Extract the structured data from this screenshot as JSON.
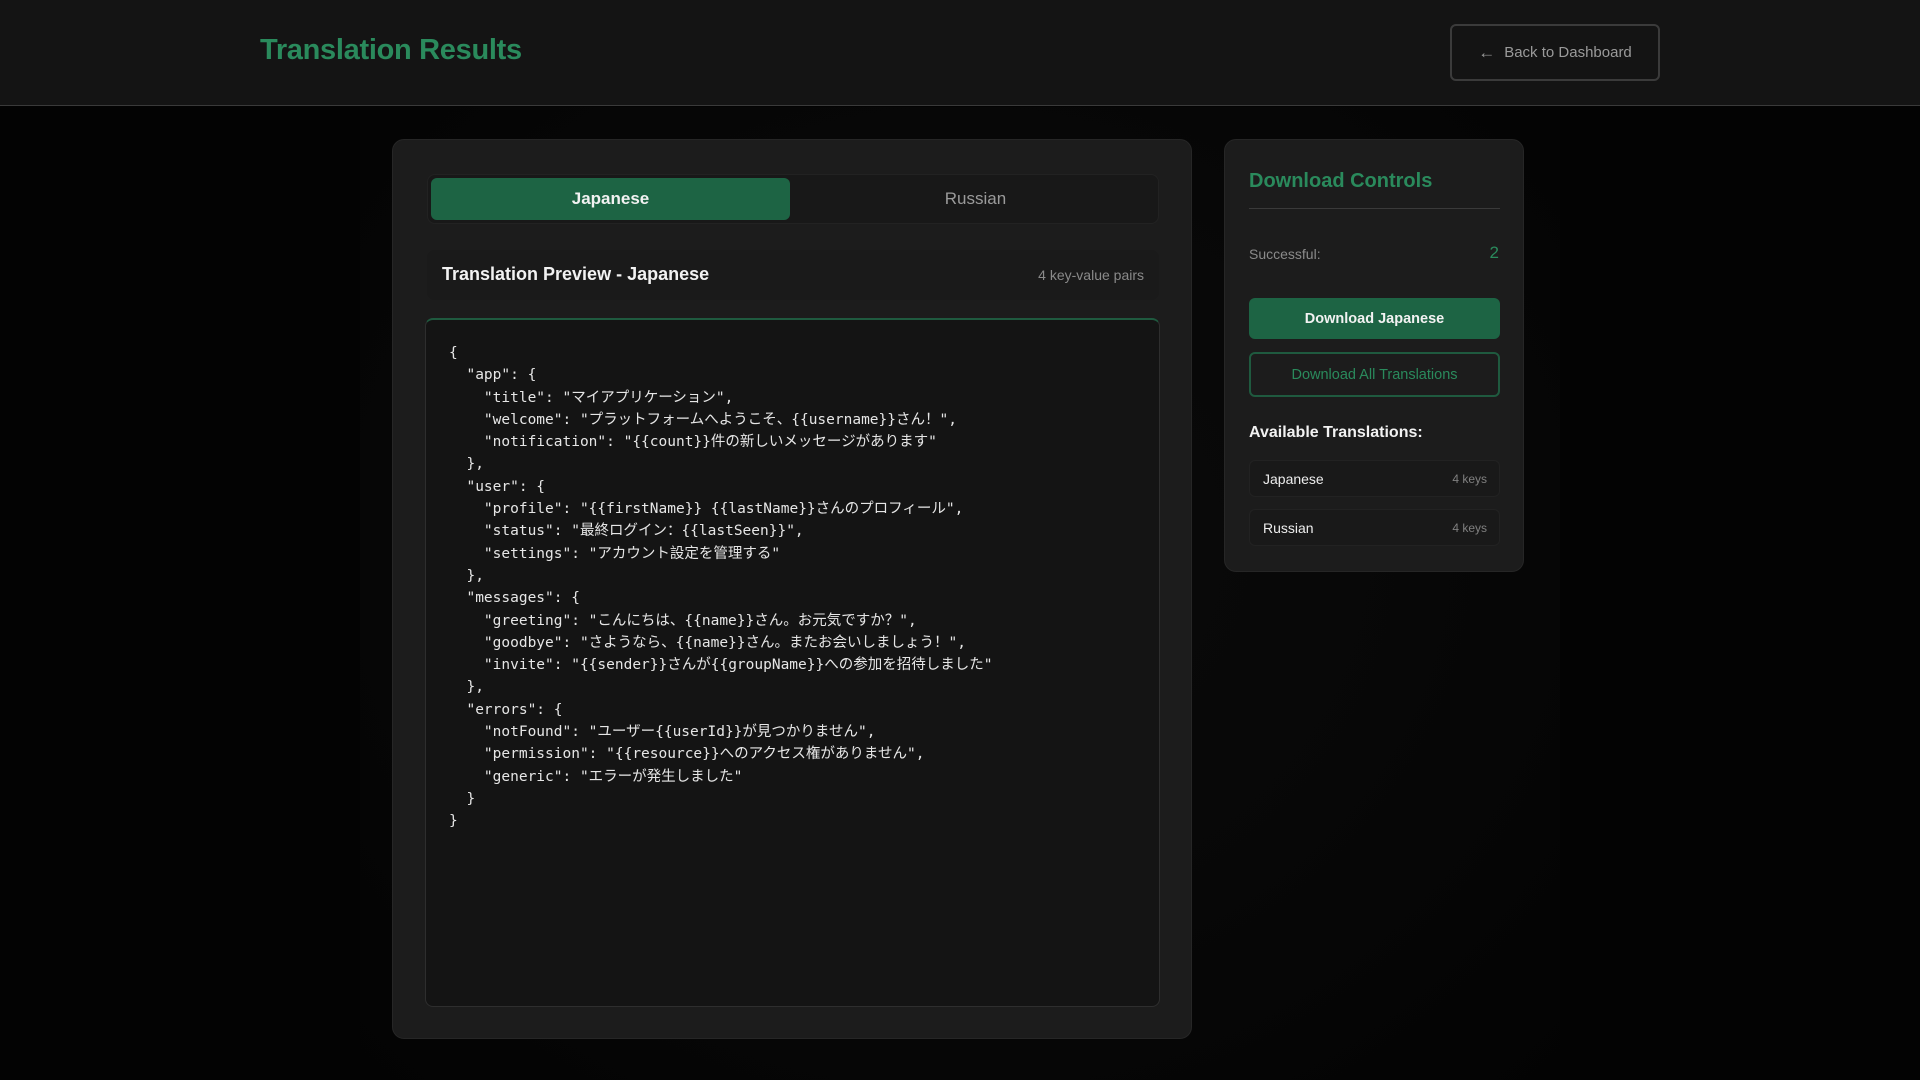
{
  "header": {
    "title": "Translation Results",
    "back_label": "Back to Dashboard",
    "back_icon": "arrow-left-icon"
  },
  "tabs": [
    {
      "label": "Japanese",
      "active": true
    },
    {
      "label": "Russian",
      "active": false
    }
  ],
  "preview": {
    "title": "Translation Preview - Japanese",
    "count": "4 key-value pairs",
    "code": "{\n  \"app\": {\n    \"title\": \"マイアプリケーション\",\n    \"welcome\": \"プラットフォームへようこそ、{{username}}さん！\",\n    \"notification\": \"{{count}}件の新しいメッセージがあります\"\n  },\n  \"user\": {\n    \"profile\": \"{{firstName}} {{lastName}}さんのプロフィール\",\n    \"status\": \"最終ログイン：{{lastSeen}}\",\n    \"settings\": \"アカウント設定を管理する\"\n  },\n  \"messages\": {\n    \"greeting\": \"こんにちは、{{name}}さん。お元気ですか？\",\n    \"goodbye\": \"さようなら、{{name}}さん。またお会いしましょう！\",\n    \"invite\": \"{{sender}}さんが{{groupName}}への参加を招待しました\"\n  },\n  \"errors\": {\n    \"notFound\": \"ユーザー{{userId}}が見つかりません\",\n    \"permission\": \"{{resource}}へのアクセス権がありません\",\n    \"generic\": \"エラーが発生しました\"\n  }\n}"
  },
  "sidebar": {
    "title": "Download Controls",
    "stat_label": "Successful:",
    "stat_value": "2",
    "download_primary": "Download Japanese",
    "download_all": "Download All Translations",
    "available_title": "Available Translations:",
    "available": [
      {
        "name": "Japanese",
        "keys": "4 keys"
      },
      {
        "name": "Russian",
        "keys": "4 keys"
      }
    ]
  },
  "colors": {
    "accent": "#2a8a5c",
    "accent_dark": "#1d6444",
    "background": "#030303",
    "panel": "#1c1c1c"
  }
}
